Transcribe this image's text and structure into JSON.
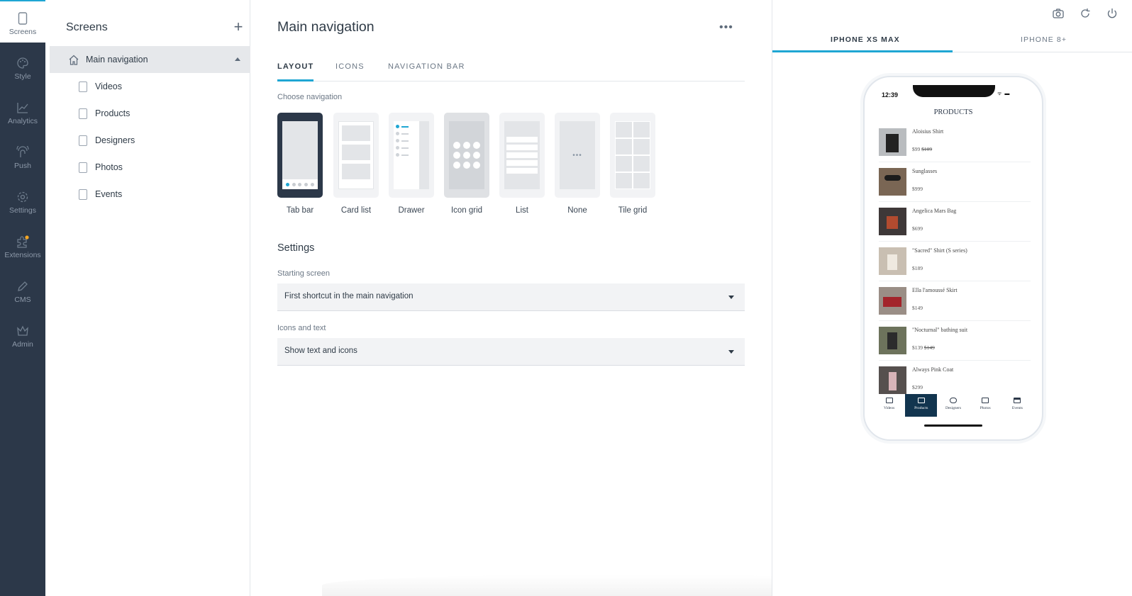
{
  "rail": {
    "items": [
      {
        "label": "Screens",
        "icon": "screens-icon"
      },
      {
        "label": "Style",
        "icon": "palette-icon"
      },
      {
        "label": "Analytics",
        "icon": "chart-icon"
      },
      {
        "label": "Push",
        "icon": "push-icon"
      },
      {
        "label": "Settings",
        "icon": "gear-icon"
      },
      {
        "label": "Extensions",
        "icon": "puzzle-icon"
      },
      {
        "label": "CMS",
        "icon": "pencil-icon"
      },
      {
        "label": "Admin",
        "icon": "crown-icon"
      }
    ],
    "badge_color": "#f5a623"
  },
  "screens": {
    "title": "Screens",
    "add_label": "+",
    "items": [
      {
        "label": "Main navigation"
      },
      {
        "label": "Videos"
      },
      {
        "label": "Products"
      },
      {
        "label": "Designers"
      },
      {
        "label": "Photos"
      },
      {
        "label": "Events"
      }
    ]
  },
  "main": {
    "title": "Main navigation",
    "more_label": "•••",
    "tabs": [
      {
        "label": "LAYOUT"
      },
      {
        "label": "ICONS"
      },
      {
        "label": "NAVIGATION BAR"
      }
    ],
    "choose_label": "Choose navigation",
    "nav_options": [
      {
        "label": "Tab bar"
      },
      {
        "label": "Card list"
      },
      {
        "label": "Drawer"
      },
      {
        "label": "Icon grid"
      },
      {
        "label": "List"
      },
      {
        "label": "None"
      },
      {
        "label": "Tile grid"
      }
    ],
    "settings_title": "Settings",
    "starting_screen": {
      "label": "Starting screen",
      "value": "First shortcut in the main navigation"
    },
    "icons_text": {
      "label": "Icons and text",
      "value": "Show text and icons"
    }
  },
  "preview": {
    "tabs": [
      {
        "label": "IPHONE XS MAX"
      },
      {
        "label": "IPHONE 8+"
      }
    ],
    "phone": {
      "time": "12:39",
      "status": "ᯤ ▬",
      "title": "PRODUCTS",
      "products": [
        {
          "name": "Aloisius Shirt",
          "price": "$99",
          "old_price": "$109"
        },
        {
          "name": "Sunglasses",
          "price": "$999",
          "old_price": ""
        },
        {
          "name": "Angelica Mars Bag",
          "price": "$699",
          "old_price": ""
        },
        {
          "name": "\"Sacred\" Shirt (S series)",
          "price": "$189",
          "old_price": ""
        },
        {
          "name": "Ella l'amoussé Skirt",
          "price": "$149",
          "old_price": ""
        },
        {
          "name": "\"Nocturnal\" bathing suit",
          "price": "$139",
          "old_price": "$149"
        },
        {
          "name": "Always Pink Coat",
          "price": "$299",
          "old_price": ""
        }
      ],
      "tabbar": [
        {
          "label": "Videos"
        },
        {
          "label": "Products"
        },
        {
          "label": "Designers"
        },
        {
          "label": "Photos"
        },
        {
          "label": "Events"
        }
      ]
    }
  },
  "colors": {
    "accent": "#1fa6d3",
    "rail_bg": "#2c3849",
    "phone_tab_active": "#12354f"
  }
}
